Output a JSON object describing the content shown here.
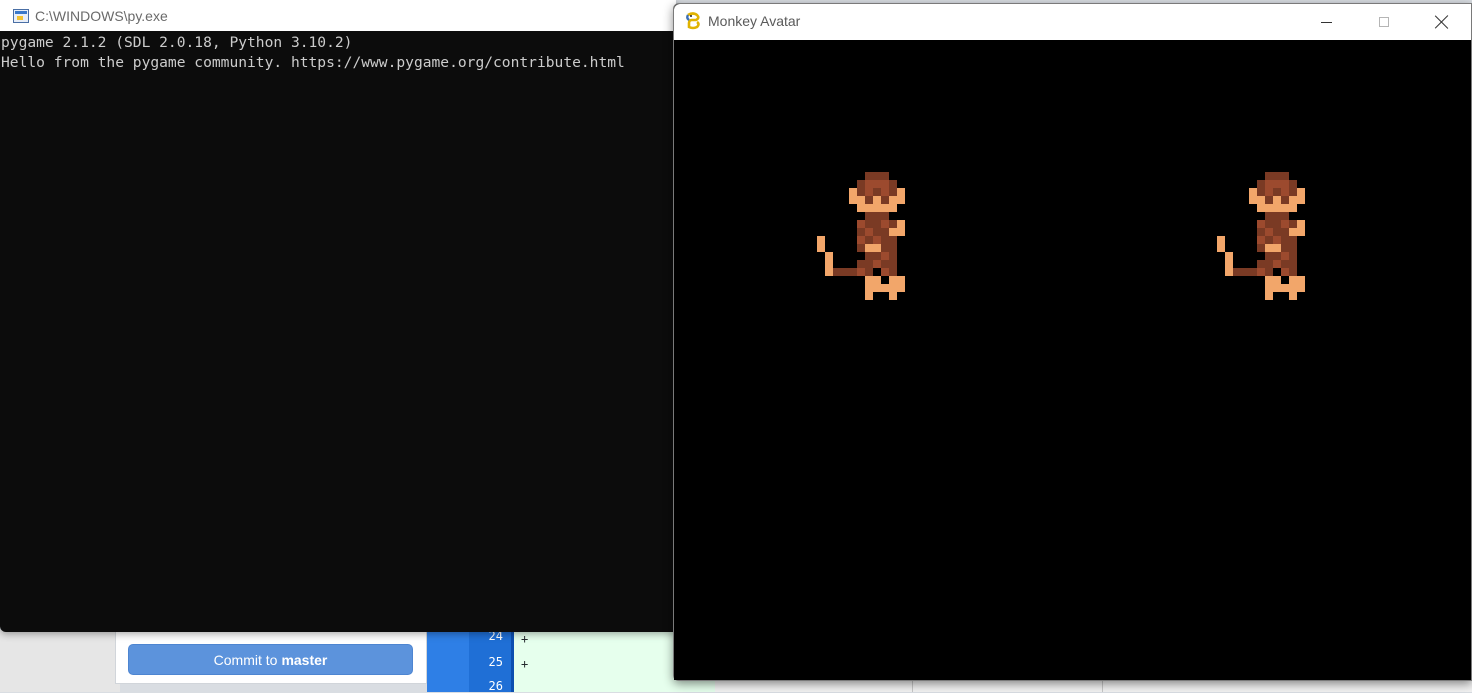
{
  "console": {
    "title": "C:\\WINDOWS\\py.exe",
    "lines": [
      "pygame 2.1.2 (SDL 2.0.18, Python 3.10.2)",
      "Hello from the pygame community. https://www.pygame.org/contribute.html"
    ]
  },
  "pygame_window": {
    "title": "Monkey Avatar",
    "icon": "pygame-snake-icon",
    "controls": [
      "minimize",
      "maximize",
      "close"
    ],
    "sprites": [
      "monkey-sprite-left",
      "monkey-sprite-right"
    ],
    "sprite_colors": {
      "dark": "#7a3a24",
      "mid": "#9c4a2e",
      "light": "#f2a66a"
    }
  },
  "github_desktop": {
    "commit_prefix": "Commit to",
    "commit_branch": "master",
    "diff_lines": [
      {
        "number": "24",
        "sign": "+"
      },
      {
        "number": "25",
        "sign": "+"
      },
      {
        "number": "26",
        "sign": ""
      }
    ],
    "colors": {
      "commit_button": "#5c93dc",
      "gutter": "#1f6fd6",
      "added_bg": "#e6ffed"
    }
  }
}
